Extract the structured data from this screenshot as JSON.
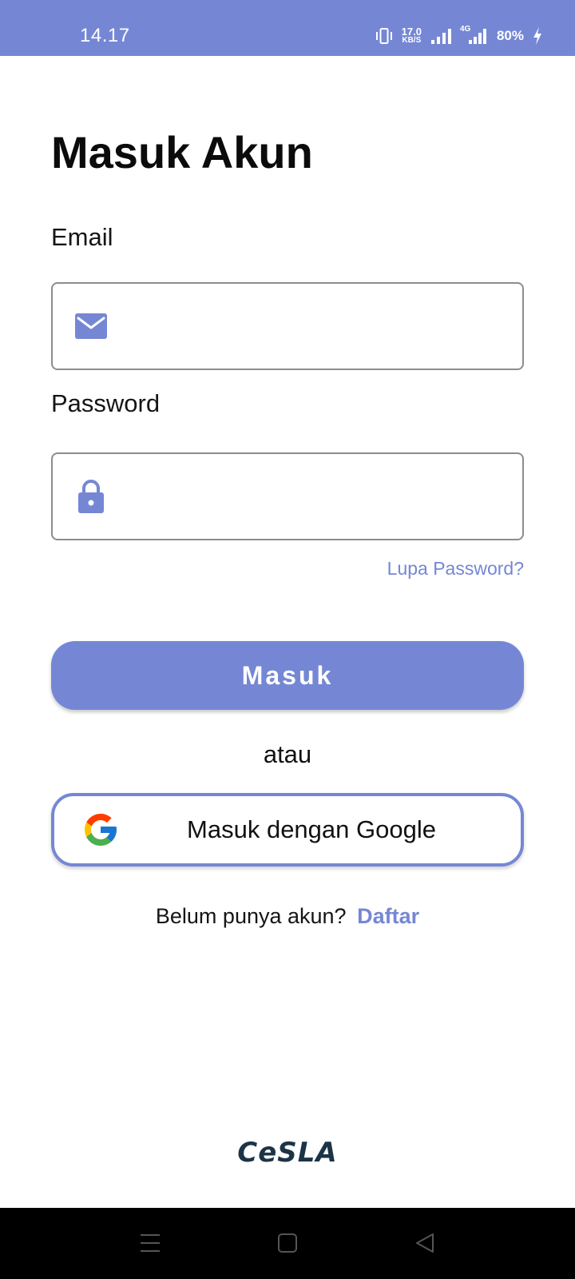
{
  "status_bar": {
    "time": "14.17",
    "net_speed_value": "17.0",
    "net_speed_unit": "KB/S",
    "network_type": "4G",
    "battery": "80%",
    "icons": [
      "vibrate-icon",
      "signal-icon",
      "4g-signal-icon",
      "charging-icon"
    ]
  },
  "login": {
    "title": "Masuk Akun",
    "email_label": "Email",
    "email_value": "",
    "password_label": "Password",
    "password_value": "",
    "forgot_label": "Lupa Password?",
    "submit_label": "Masuk",
    "divider": "atau",
    "google_label": "Masuk dengan Google",
    "register_prompt": "Belum punya akun?",
    "register_link": "Daftar"
  },
  "brand": {
    "logo_text": "CeSLA"
  },
  "nav": {
    "icons": [
      "menu-icon",
      "home-icon",
      "back-icon"
    ]
  },
  "colors": {
    "accent": "#7587d4",
    "status_bar": "#7587d4",
    "nav_bar": "#000000",
    "brand_text": "#1d3447"
  }
}
